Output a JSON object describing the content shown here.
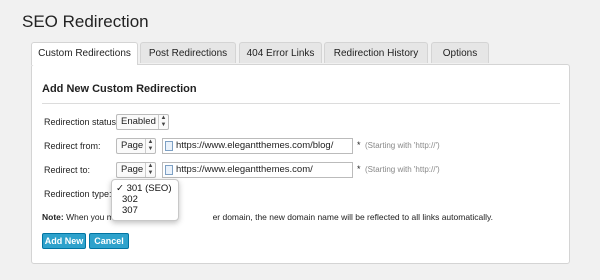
{
  "page_title": "SEO Redirection",
  "tabs": [
    {
      "label": "Custom Redirections",
      "active": true
    },
    {
      "label": "Post Redirections",
      "active": false
    },
    {
      "label": "404 Error Links",
      "active": false
    },
    {
      "label": "Redirection History",
      "active": false
    },
    {
      "label": "Options",
      "active": false
    }
  ],
  "form": {
    "section_title": "Add New Custom Redirection",
    "status_label": "Redirection status:",
    "status_value": "Enabled",
    "from_label": "Redirect from:",
    "from_type": "Page",
    "from_url": "https://www.elegantthemes.com/blog/",
    "to_label": "Redirect to:",
    "to_type": "Page",
    "to_url": "https://www.elegantthemes.com/",
    "required_mark": "*",
    "hint": "(Starting with 'http://')",
    "type_label": "Redirection type:",
    "type_options": [
      "301 (SEO)",
      "302",
      "307"
    ],
    "type_selected_mark": "✓",
    "note_label": "Note:",
    "note_text_start": "When you mo",
    "note_text_end": "er domain, the new domain name will be reflected to all links automatically."
  },
  "buttons": {
    "add_new": "Add New",
    "cancel": "Cancel"
  },
  "colors": {
    "button_bg": "#2ea2cc",
    "button_border": "#0074a2",
    "panel_bg": "#ffffff",
    "page_bg": "#f1f1f1"
  }
}
